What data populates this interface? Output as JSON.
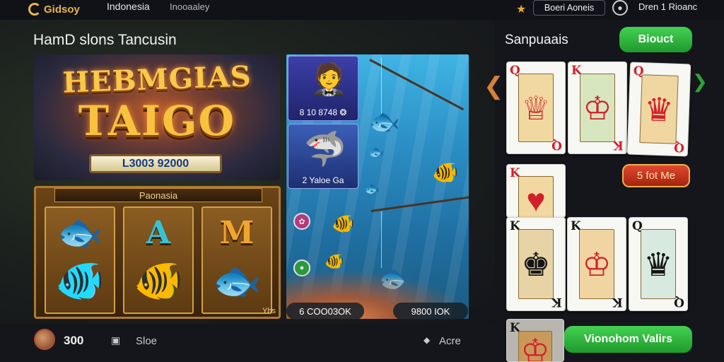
{
  "topbar": {
    "brand": "Gidsoy",
    "nav1": "Indonesia",
    "nav2": "Inooaaley",
    "button_label": "Boeri Aoneis",
    "user_label": "Dren 1 Rioanc"
  },
  "section_title": "HamD slons  Tancusin",
  "hero": {
    "title_line1": "HEBMGIAS",
    "title_line2": "TAIGO",
    "amount": "L3003 92000"
  },
  "slot_game": {
    "header": "Paonasia",
    "reels": [
      {
        "letter": "",
        "letter_color": "#e0a82e"
      },
      {
        "letter": "A",
        "letter_color": "#35c3d8"
      },
      {
        "letter": "M",
        "letter_color": "#f2a52c"
      }
    ],
    "corner": "Yhs"
  },
  "fishing_game": {
    "card1_label": "8 10 8748 ❂",
    "card2_label": "2 Yaloe Ga",
    "stat1": "6 COO03OK",
    "stat2": "9800 IOK"
  },
  "right_panel": {
    "title": "Sanpuaais",
    "select_button": "Biouct",
    "red_button": "5 fot Me",
    "bottom_button": "Vionohom Valirs"
  },
  "cards": [
    {
      "rank": "Q",
      "suit": "♦",
      "color": "red"
    },
    {
      "rank": "K",
      "suit": "♦",
      "color": "red"
    },
    {
      "rank": "Q",
      "suit": "♥",
      "color": "red"
    },
    {
      "rank": "K",
      "suit": "♥",
      "color": "red"
    },
    {
      "rank": "K",
      "suit": "♠",
      "color": "blk"
    },
    {
      "rank": "K",
      "suit": "♠",
      "color": "blk"
    },
    {
      "rank": "Q",
      "suit": "♠",
      "color": "blk"
    },
    {
      "rank": "K",
      "suit": "♠",
      "color": "blk"
    }
  ],
  "bottombar": {
    "balance": "300",
    "slots_label": "Sloe",
    "more_label": "Acre"
  },
  "colors": {
    "accent_green": "#2fb53e",
    "accent_red": "#c7321b",
    "gold": "#f7c23e"
  }
}
